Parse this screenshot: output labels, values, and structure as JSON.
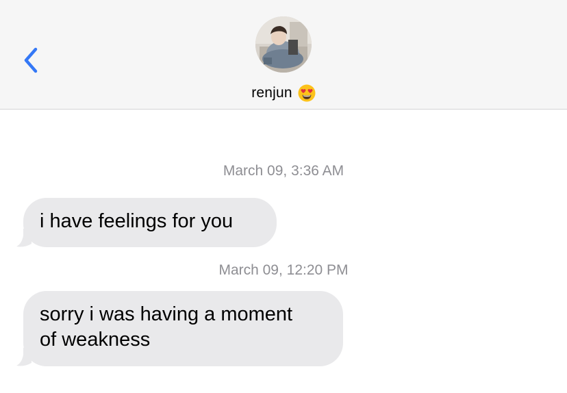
{
  "header": {
    "back_icon": "chevron-left-icon",
    "contact_name": "renjun",
    "contact_emoji": "😍",
    "accent_color": "#3478f6",
    "background_color": "#f6f6f6"
  },
  "messages": [
    {
      "timestamp": "March 09, 3:36 AM",
      "lines": [
        "i have feelings for you"
      ],
      "direction": "received"
    },
    {
      "timestamp": "March 09, 12:20 PM",
      "lines": [
        "sorry i was having a moment",
        "of weakness"
      ],
      "direction": "received"
    }
  ],
  "colors": {
    "received_bubble": "#e9e9eb",
    "timestamp_text": "#8e8e93"
  }
}
